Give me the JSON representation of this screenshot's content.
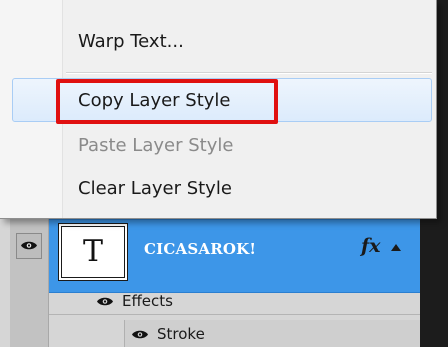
{
  "context_menu": {
    "items": [
      {
        "label": "Warp Text...",
        "enabled": true
      },
      {
        "label": "Copy Layer Style",
        "enabled": true,
        "highlighted": true
      },
      {
        "label": "Paste Layer Style",
        "enabled": false
      },
      {
        "label": "Clear Layer Style",
        "enabled": true
      }
    ],
    "highlight_color": "#e01010"
  },
  "layers_panel": {
    "selected_layer": {
      "thumbnail_glyph": "T",
      "name": "CICASAROK!",
      "fx_label": "fx",
      "row_color": "#3d96e8"
    },
    "effects": {
      "label": "Effects",
      "children": [
        {
          "label": "Stroke"
        }
      ]
    },
    "icons": {
      "visibility": "eye-icon",
      "collapse": "triangle-up-icon"
    }
  }
}
